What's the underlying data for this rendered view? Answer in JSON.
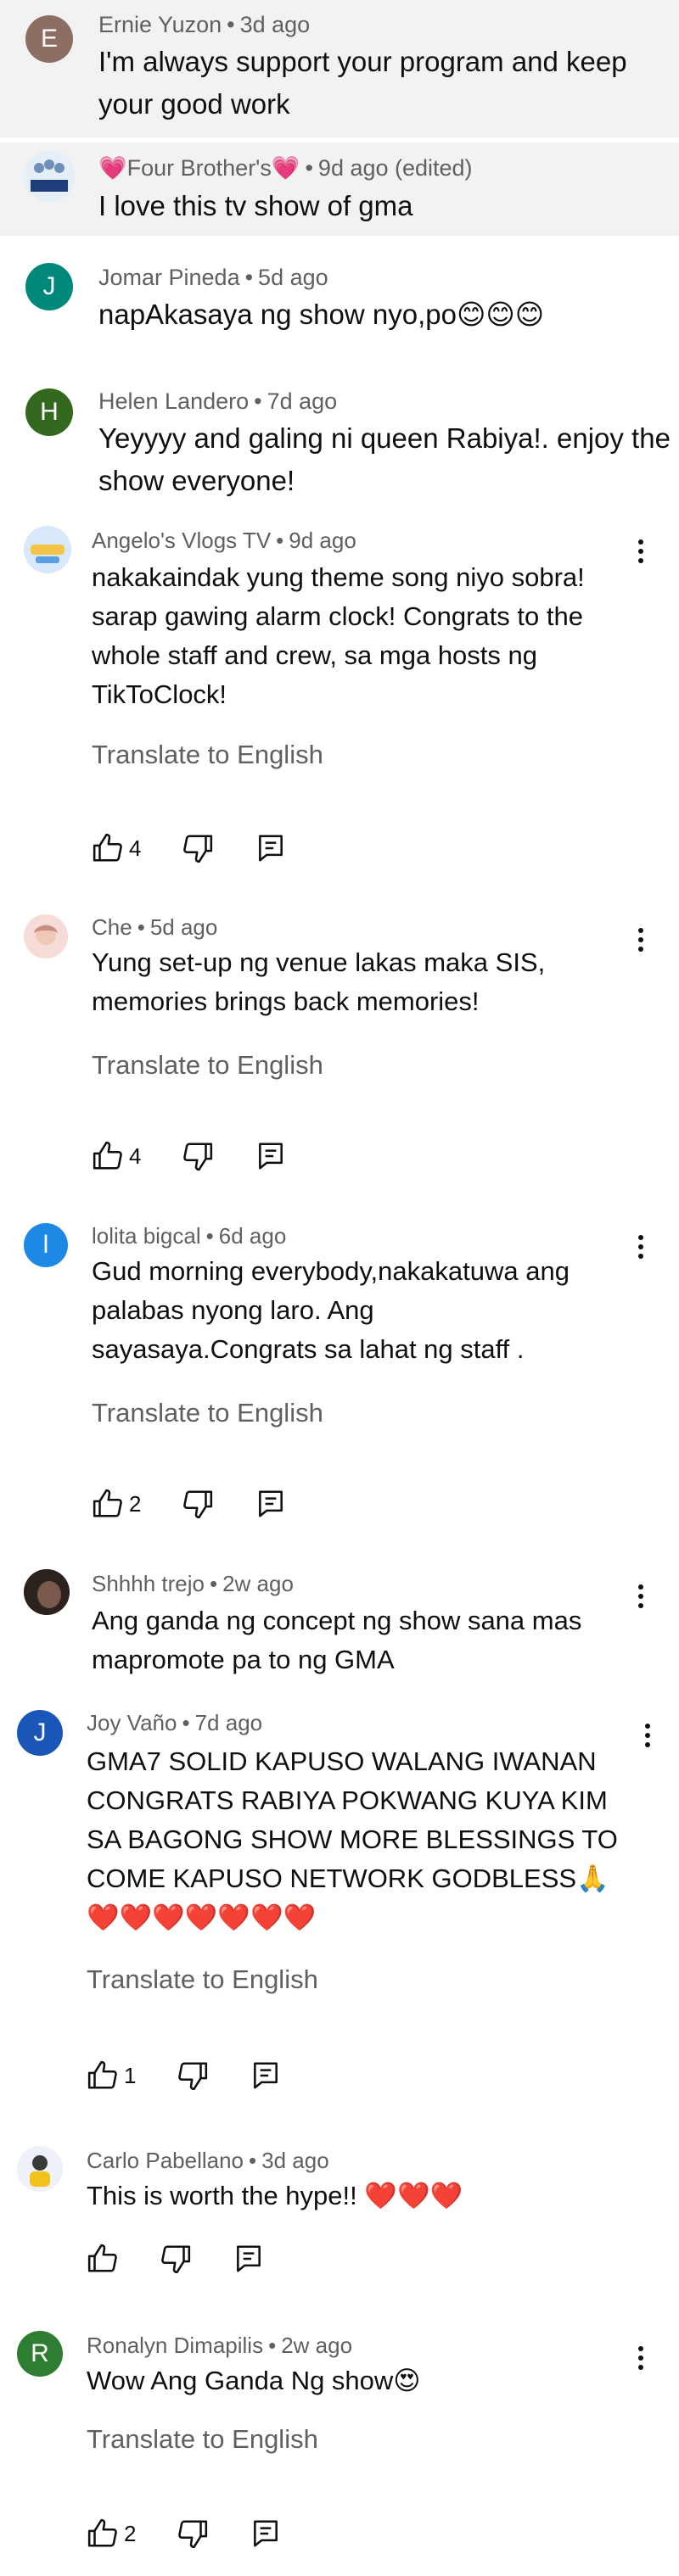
{
  "comments": [
    {
      "author": "Ernie Yuzon",
      "time": "3d ago",
      "text": "I'm always support your program and keep your good work",
      "avatar_letter": "E",
      "avatar_color": "#8d6e63"
    },
    {
      "author_prefix": "💗",
      "author": "Four Brother's",
      "author_suffix": "💗",
      "time": "9d ago (edited)",
      "text": "I love this tv show of gma",
      "avatar_label": "FOUR BROTHERS"
    },
    {
      "author": "Jomar Pineda",
      "time": "5d ago",
      "text": "napAkasaya ng show nyo,po😊😊😊",
      "avatar_letter": "J",
      "avatar_color": "#00897b"
    },
    {
      "author": "Helen Landero",
      "time": "7d ago",
      "text": "Yeyyyy and galing ni queen Rabiya!. enjoy the show everyone!",
      "avatar_letter": "H",
      "avatar_color": "#33691e"
    },
    {
      "author": "Angelo's Vlogs TV",
      "time": "9d ago",
      "text": "nakakaindak yung theme song niyo sobra! sarap gawing alarm clock! Congrats to the whole staff and crew, sa mga hosts ng TikToClock!",
      "translate": "Translate to English",
      "likes": "4"
    },
    {
      "author": "Che",
      "time": "5d ago",
      "text": "Yung set-up ng venue lakas maka SIS, memories brings back memories!",
      "translate": "Translate to English",
      "likes": "4"
    },
    {
      "author": "lolita bigcal",
      "time": "6d ago",
      "text": "Gud morning everybody,nakakatuwa ang palabas nyong laro. Ang sayasaya.Congrats sa lahat ng staff .",
      "translate": "Translate to English",
      "likes": "2",
      "avatar_letter": "l",
      "avatar_color": "#1e88e5"
    },
    {
      "author": "Shhhh trejo",
      "time": "2w ago",
      "text": "Ang ganda ng concept ng show sana mas mapromote pa to ng GMA"
    },
    {
      "author": "Joy Vaño",
      "time": "7d ago",
      "text": "GMA7 SOLID KAPUSO WALANG IWANAN CONGRATS RABIYA POKWANG KUYA KIM SA BAGONG SHOW MORE BLESSINGS TO COME KAPUSO NETWORK GODBLESS🙏 ❤️❤️❤️❤️❤️❤️❤️",
      "translate": "Translate to English",
      "likes": "1",
      "avatar_letter": "J",
      "avatar_color": "#1a56b8"
    },
    {
      "author": "Carlo Pabellano",
      "time": "3d ago",
      "text": "This is worth the hype!! ❤️❤️❤️"
    },
    {
      "author": "Ronalyn Dimapilis",
      "time": "2w ago",
      "text": "Wow Ang Ganda Ng show😍",
      "translate": "Translate to English",
      "likes": "2",
      "avatar_letter": "R",
      "avatar_color": "#2e7d32"
    }
  ],
  "icons": {
    "like": "thumbs-up-icon",
    "dislike": "thumbs-down-icon",
    "reply": "reply-icon",
    "more": "more-vert-icon"
  }
}
